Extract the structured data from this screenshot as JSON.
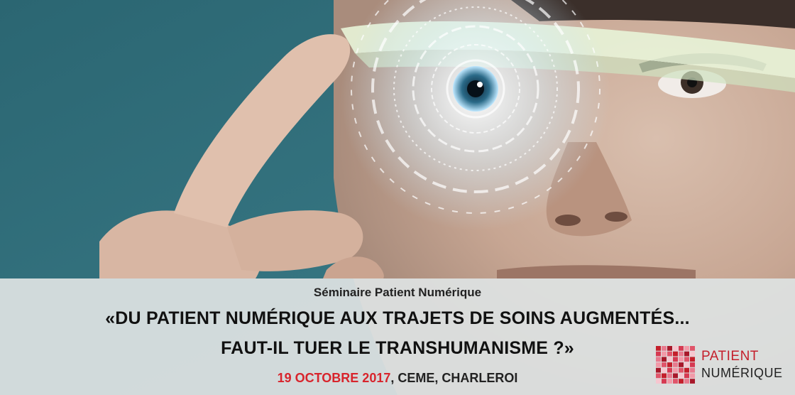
{
  "seminar": "Séminaire Patient Numérique",
  "headline_line1": "«DU PATIENT NUMÉRIQUE AUX TRAJETS DE SOINS AUGMENTÉS...",
  "headline_line2": "FAUT-IL TUER LE TRANSHUMANISME ?»",
  "date": "19 OCTOBRE 2017",
  "location": ", CEME, CHARLEROI",
  "logo": {
    "line1": "PATIENT",
    "line2": "NUMÉRIQUE"
  },
  "colors": {
    "accent": "#d8242c",
    "logo_red": "#c41f2b",
    "caption_bg": "#dee2e2",
    "teal_bg": "#2f6f7c"
  }
}
